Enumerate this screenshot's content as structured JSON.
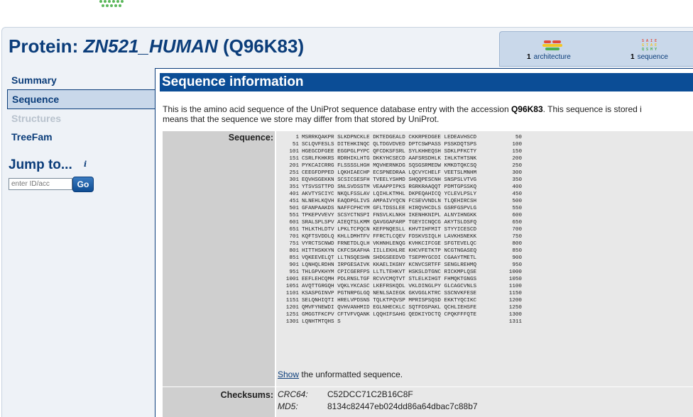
{
  "header": {
    "title_prefix": "Protein: ",
    "protein_name": "ZN521_HUMAN",
    "accession_paren": "(Q96K83)"
  },
  "stats": {
    "architecture_count": "1",
    "architecture_label": "architecture",
    "sequence_count": "1",
    "sequence_label": "sequence"
  },
  "sidebar": {
    "items": [
      {
        "label": "Summary"
      },
      {
        "label": "Sequence"
      },
      {
        "label": "Structures"
      },
      {
        "label": "TreeFam"
      }
    ],
    "jump_label": "Jump to...",
    "jump_input_placeholder": "enter ID/acc",
    "go_label": "Go"
  },
  "content": {
    "section_title": "Sequence information",
    "intro_line1_a": "This is the amino acid sequence of the UniProt sequence database entry with the accession ",
    "intro_accession": "Q96K83",
    "intro_line1_b": ". This sequence is stored i",
    "intro_line2": "means that the sequence we store may differ from that stored by UniProt.",
    "sequence_label": "Sequence:",
    "sequence_rows": [
      {
        "start": "1",
        "seq": "MSRRKQAKPR SLKDPNCKLE DKTEDGEALD CKKRPEDGEE LEDEAVHSCD",
        "end": "50"
      },
      {
        "start": "51",
        "seq": "SCLQVFESLS DITEHKINQC QLTDGVDVED DPTCSWPASS PSSKDQTSPS",
        "end": "100"
      },
      {
        "start": "101",
        "seq": "HGEGCDFGEE EGGPGLPYPC QFCDKSFSRL SYLKHHEQSH SDKLPFKCTY",
        "end": "150"
      },
      {
        "start": "151",
        "seq": "CSRLFKHKRS RDRHIKLHTG DKKYHCSECD AAFSRSDHLK IHLKTHTSNK",
        "end": "200"
      },
      {
        "start": "201",
        "seq": "PYKCAICRRG FLSSSSLHGH MQVHERNKDG SQSGSRMEDW KMKDTQKCSQ",
        "end": "250"
      },
      {
        "start": "251",
        "seq": "CEEGFDPPED LQKHIAECHP ECSPNEDRAA LQCVYCHELF VEETSLMNHM",
        "end": "300"
      },
      {
        "start": "301",
        "seq": "EQVHSGEKKN SCSICSESFH TVEELYSHMD SHQQPESCNH SNSPSLVTVG",
        "end": "350"
      },
      {
        "start": "351",
        "seq": "YTSVSSTTPD SNLSVDSSTM VEAAPPIPKS RGRKRAAQQT PDMTGPSSKQ",
        "end": "400"
      },
      {
        "start": "401",
        "seq": "AKVTYSCIYC NKQLFSSLAV LQIHLKTMHL DKPEQAHICQ YCLEVLPSLY",
        "end": "450"
      },
      {
        "start": "451",
        "seq": "NLNEHLKQVH EAQDPGLIVS AMPAIVYQCN FCSEVVNDLN TLQEHIRCSH",
        "end": "500"
      },
      {
        "start": "501",
        "seq": "GFANPAAKDS NAFFCPHCYM GFLTDSSLEE HIRQVHCDLS GSRFGSPVLG",
        "end": "550"
      },
      {
        "start": "551",
        "seq": "TPKEPVVEVY SCSYCTNSPI FNSVLKLNKH IKENHKNIPL ALNYIHNGKK",
        "end": "600"
      },
      {
        "start": "601",
        "seq": "SRALSPLSPV AIEQTSLKMM QAVGGAPARP TGEYICNQCG AKYTSLDSFQ",
        "end": "650"
      },
      {
        "start": "651",
        "seq": "THLKTHLDTV LPKLTCPQCN KEFPNQESLL KHVTIHFMIT STYYICESCD",
        "end": "700"
      },
      {
        "start": "701",
        "seq": "KQFTSVDDLQ KHLLDMHTFV FFRCTLCQEV FDSKVSIQLH LAVKHSNEKK",
        "end": "750"
      },
      {
        "start": "751",
        "seq": "VYRCTSCNWD FRNETDLQLH VKHNHLENQG KVHKCIFCGE SFGTEVELQC",
        "end": "800"
      },
      {
        "start": "801",
        "seq": "HITTHSKKYN CKFCSKAFHA IILLEKHLRE KHCVFETKTP NCGTNGASEQ",
        "end": "850"
      },
      {
        "start": "851",
        "seq": "VQKEEVELQT LLTNSQESHN SHDGSEEDVD TSEPMYGCDI CGAAYTMETL",
        "end": "900"
      },
      {
        "start": "901",
        "seq": "LQNHQLRDHN IRPGESAIVK KKAELIKGNY KCNVCSRTFF SENGLREHMQ",
        "end": "950"
      },
      {
        "start": "951",
        "seq": "THLGPVKHYM CPICGERFPS LLTLTEHKVT HSKSLDTGNC RICKMPLQSE",
        "end": "1000"
      },
      {
        "start": "1001",
        "seq": "EEFLEHCQMH PDLRNSLTGF RCVVCMQTVT STLELKIHGT FHMQKTGNGS",
        "end": "1050"
      },
      {
        "start": "1051",
        "seq": "AVQTTGRGQH VQKLYKCASC LKEFRSKQDL VKLDINGLPY GLCAGCVNLS",
        "end": "1100"
      },
      {
        "start": "1101",
        "seq": "KSASPGINVP PGTNRPGLGQ NENLSAIEGK GKVGGLKTRC SSCNVKFESE",
        "end": "1150"
      },
      {
        "start": "1151",
        "seq": "SELQNHIQTI HRELVPDSNS TQLKTPQVSP MPRISPSQSD EKKTYQCIKC",
        "end": "1200"
      },
      {
        "start": "1201",
        "seq": "QMVFYNEWDI QVHVANHMID EGLNHECKLC SQTFDSPAKL QCHLIEHSFE",
        "end": "1250"
      },
      {
        "start": "1251",
        "seq": "GMGGTFKCPV CFTVFVQANK LQQHIFSAHG QEDKIYDCTQ CPQKFFFQTE",
        "end": "1300"
      },
      {
        "start": "1301",
        "seq": "LQNHTMTQHS S",
        "end": "1311"
      }
    ],
    "show_link": "Show",
    "show_rest": " the unformatted sequence.",
    "checksums_label": "Checksums:",
    "checksums": [
      {
        "name": "CRC64:",
        "value": "C52DCC71C2B16C8F"
      },
      {
        "name": "MD5:",
        "value": "8134c82447eb024dd86a64dbac7c88b7"
      }
    ]
  },
  "colors": {
    "brand_blue": "#0b4d96",
    "nav_active_bg": "#c9d8ea",
    "logo_green": "#5cb85c"
  }
}
